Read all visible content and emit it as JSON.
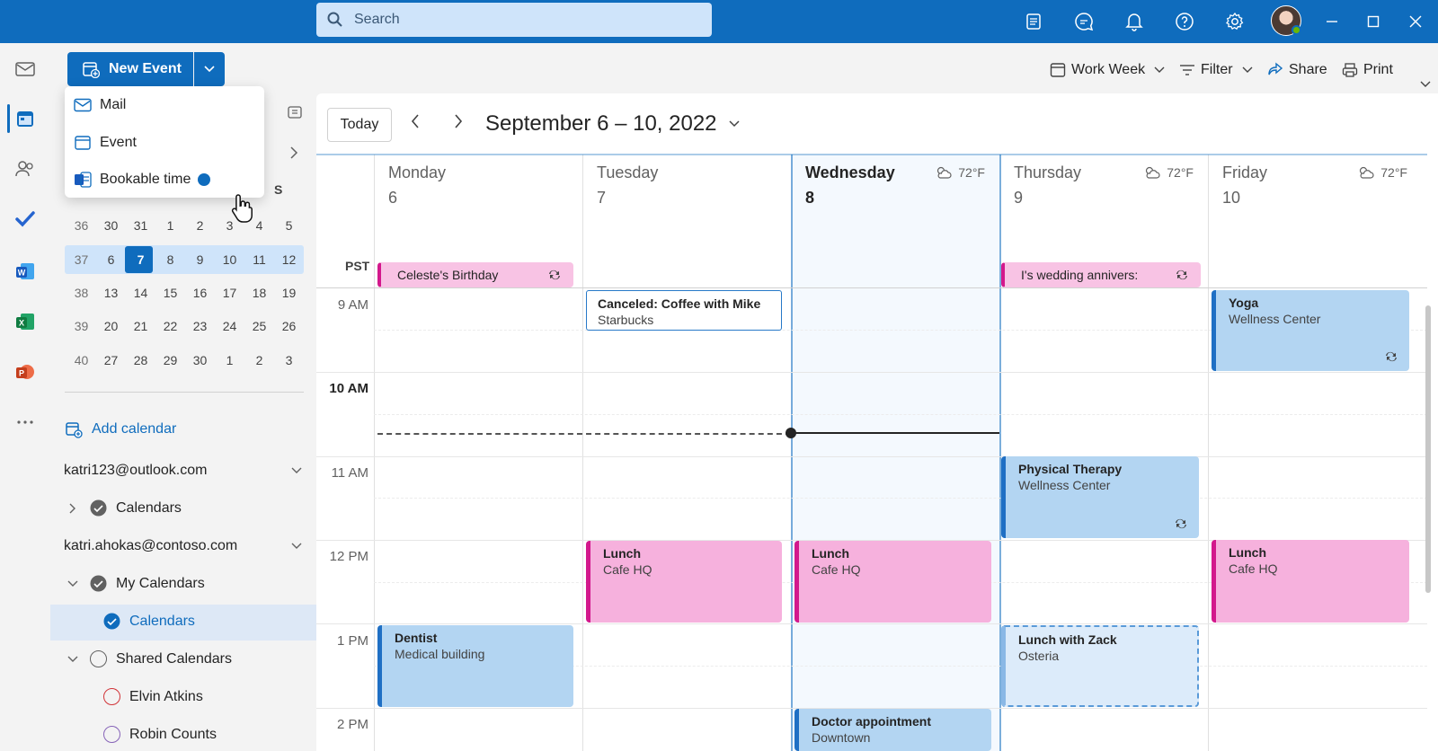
{
  "topbar": {
    "search_placeholder": "Search",
    "icons": [
      "notes-icon",
      "chat-icon",
      "bell-icon",
      "help-icon",
      "gear-icon"
    ],
    "window_controls": [
      "minimize-icon",
      "maximize-icon",
      "close-icon"
    ]
  },
  "rail": {
    "apps": [
      "mail-icon",
      "calendar-icon",
      "people-icon",
      "todo-icon",
      "word-icon",
      "excel-icon",
      "powerpoint-icon",
      "more-icon"
    ],
    "active": "calendar-icon"
  },
  "command_bar": {
    "new_event": "New Event",
    "view": "Work Week",
    "filter": "Filter",
    "share": "Share",
    "print": "Print"
  },
  "dropdown": {
    "items": [
      {
        "label": "Mail",
        "icon": "mail-icon"
      },
      {
        "label": "Event",
        "icon": "calendar-icon"
      },
      {
        "label": "Bookable time",
        "icon": "bookable-icon"
      }
    ]
  },
  "mini_calendar": {
    "visible_header": "S",
    "rows": [
      [
        "36",
        "30",
        "31",
        "1",
        "2",
        "3",
        "4",
        "5"
      ],
      [
        "37",
        "6",
        "7",
        "8",
        "9",
        "10",
        "11",
        "12"
      ],
      [
        "38",
        "13",
        "14",
        "15",
        "16",
        "17",
        "18",
        "19"
      ],
      [
        "39",
        "20",
        "21",
        "22",
        "23",
        "24",
        "25",
        "26"
      ],
      [
        "40",
        "27",
        "28",
        "29",
        "30",
        "1",
        "2",
        "3"
      ]
    ],
    "selected_week_index": 1,
    "today": "7"
  },
  "left_pane": {
    "add_calendar": "Add calendar",
    "accounts": [
      {
        "email": "katri123@outlook.com"
      },
      {
        "email": "katri.ahokas@contoso.com"
      }
    ],
    "calendars_label": "Calendars",
    "my_calendars": "My Calendars",
    "selected_calendar": "Calendars",
    "shared_calendars": "Shared Calendars",
    "shared": [
      {
        "name": "Elvin Atkins",
        "color": "#d13438"
      },
      {
        "name": "Robin Counts",
        "color": "#8764b8"
      }
    ]
  },
  "calendar": {
    "today_button": "Today",
    "range_title": "September 6 – 10, 2022",
    "timezone": "PST",
    "days": [
      {
        "name": "Monday",
        "num": "6",
        "weather": ""
      },
      {
        "name": "Tuesday",
        "num": "7",
        "weather": ""
      },
      {
        "name": "Wednesday",
        "num": "8",
        "weather": "72°F"
      },
      {
        "name": "Thursday",
        "num": "9",
        "weather": "72°F"
      },
      {
        "name": "Friday",
        "num": "10",
        "weather": "72°F"
      }
    ],
    "hours": [
      "9 AM",
      "10 AM",
      "11 AM",
      "12 PM",
      "1 PM",
      "2 PM"
    ],
    "allday_events": [
      {
        "title": "Celeste's Birthday",
        "day": "Monday",
        "recurring": true
      },
      {
        "title": "I's wedding annivers:",
        "day": "Thursday",
        "recurring": true
      }
    ],
    "events": [
      {
        "title": "Canceled: Coffee with Mike",
        "location": "Starbucks",
        "day": "Tuesday"
      },
      {
        "title": "Yoga",
        "location": "Wellness Center",
        "day": "Friday",
        "recurring": true
      },
      {
        "title": "Physical Therapy",
        "location": "Wellness Center",
        "day": "Thursday",
        "recurring": true
      },
      {
        "title": "Lunch",
        "location": "Cafe HQ",
        "day": "Tuesday"
      },
      {
        "title": "Lunch",
        "location": "Cafe HQ",
        "day": "Wednesday"
      },
      {
        "title": "Lunch",
        "location": "Cafe HQ",
        "day": "Friday"
      },
      {
        "title": "Dentist",
        "location": "Medical building",
        "day": "Monday"
      },
      {
        "title": "Lunch with Zack",
        "location": "Osteria",
        "day": "Thursday"
      },
      {
        "title": "Doctor appointment",
        "location": "Downtown",
        "day": "Wednesday"
      }
    ]
  },
  "colors": {
    "brand": "#0f6cbd",
    "event_blue": "#b3d5f2",
    "event_pink": "#f6b1dd"
  }
}
